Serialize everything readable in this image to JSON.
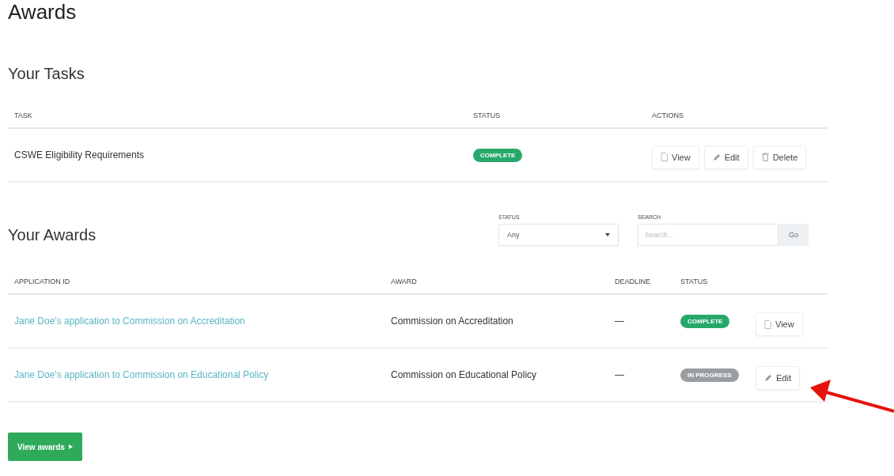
{
  "page_title": "Awards",
  "tasks": {
    "title": "Your Tasks",
    "columns": [
      "TASK",
      "STATUS",
      "ACTIONS"
    ],
    "rows": [
      {
        "task": "CSWE Eligibility Requirements",
        "status": {
          "label": "COMPLETE",
          "kind": "complete"
        },
        "actions": [
          {
            "kind": "view",
            "label": "View"
          },
          {
            "kind": "edit",
            "label": "Edit"
          },
          {
            "kind": "delete",
            "label": "Delete"
          }
        ]
      }
    ]
  },
  "awards": {
    "title": "Your Awards",
    "filters": {
      "status_label": "STATUS",
      "status_value": "Any",
      "search_label": "SEARCH",
      "search_placeholder": "Search...",
      "go_label": "Go"
    },
    "columns": [
      "APPLICATION ID",
      "AWARD",
      "DEADLINE",
      "STATUS"
    ],
    "rows": [
      {
        "application": "Jane Doe's application to Commission on Accreditation",
        "award": "Commission on Accreditation",
        "deadline": "—",
        "status": {
          "label": "COMPLETE",
          "kind": "complete"
        },
        "actions": [
          {
            "kind": "view",
            "label": "View"
          }
        ]
      },
      {
        "application": "Jane Doe's application to Commission on Educational Policy",
        "award": "Commission on Educational Policy",
        "deadline": "—",
        "status": {
          "label": "IN PROGRESS",
          "kind": "in_progress"
        },
        "actions": [
          {
            "kind": "edit",
            "label": "Edit"
          }
        ]
      }
    ]
  },
  "view_awards_button": "View awards"
}
